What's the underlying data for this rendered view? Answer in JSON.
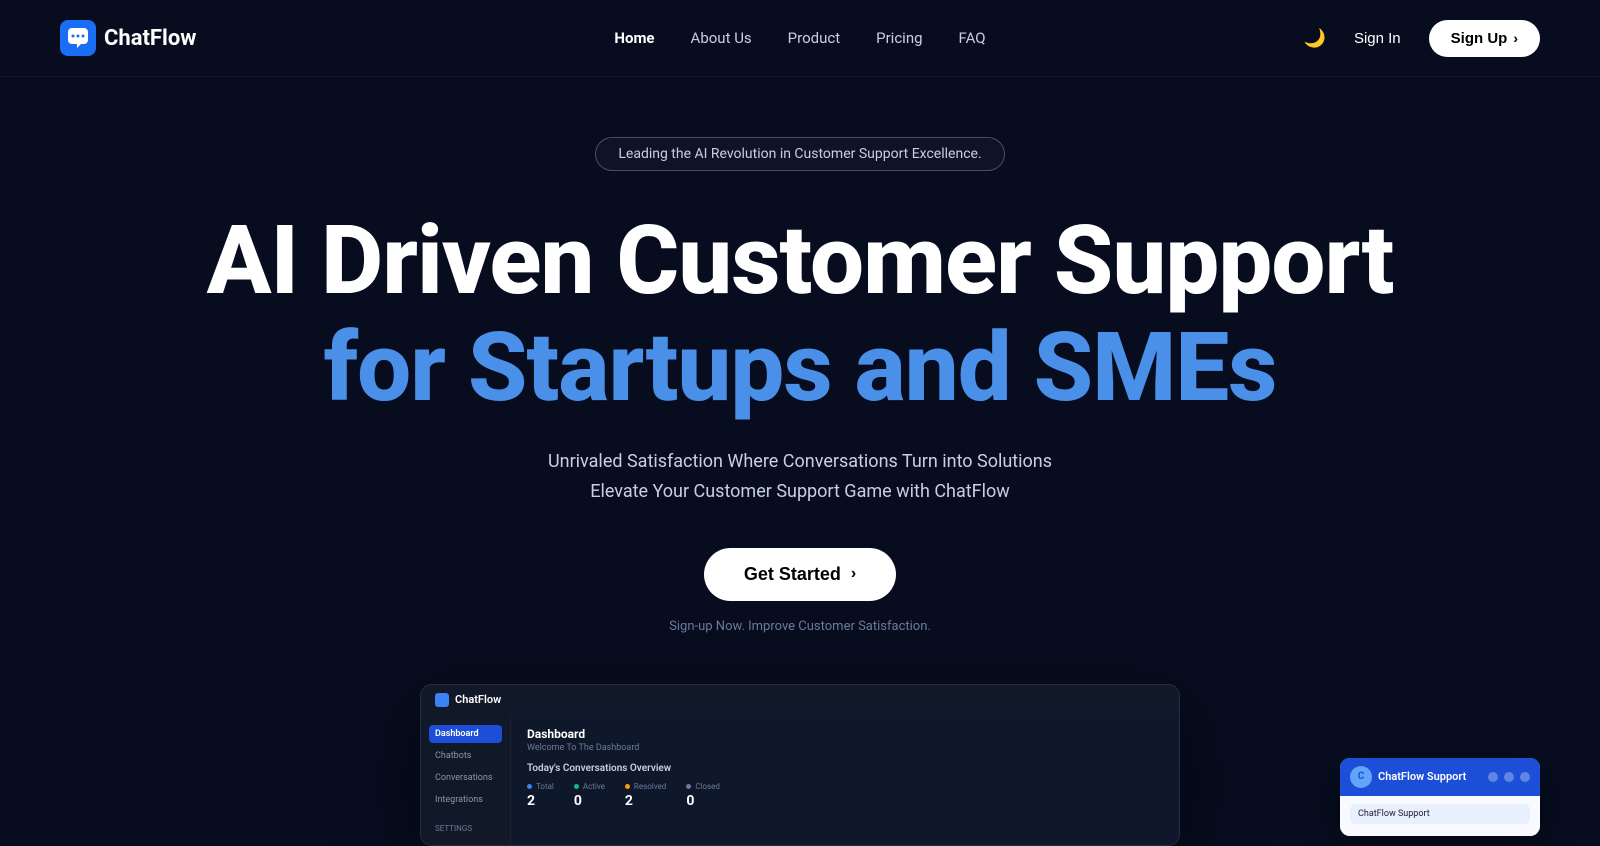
{
  "brand": {
    "name": "ChatFlow",
    "logo_alt": "ChatFlow logo"
  },
  "nav": {
    "links": [
      {
        "label": "Home",
        "active": true
      },
      {
        "label": "About Us",
        "active": false
      },
      {
        "label": "Product",
        "active": false
      },
      {
        "label": "Pricing",
        "active": false
      },
      {
        "label": "FAQ",
        "active": false
      }
    ],
    "sign_in": "Sign In",
    "sign_up": "Sign Up",
    "dark_mode_icon": "🌙"
  },
  "hero": {
    "badge": "Leading the AI Revolution in Customer Support Excellence.",
    "title_line1": "AI Driven Customer Support",
    "title_line2": "for Startups and SMEs",
    "subtitle_line1": "Unrivaled Satisfaction Where Conversations Turn into Solutions",
    "subtitle_line2": "Elevate Your Customer Support Game with ChatFlow",
    "cta_label": "Get Started",
    "footnote": "Sign-up Now. Improve Customer Satisfaction."
  },
  "dashboard": {
    "brand": "ChatFlow",
    "topbar_title": "Dashboard",
    "topbar_subtitle": "Welcome To The Dashboard",
    "sidebar_items": [
      "Dashboard",
      "Chatbots",
      "Conversations",
      "Integrations"
    ],
    "sidebar_settings_label": "SETTINGS",
    "overview_title": "Today's Conversations Overview",
    "stats": [
      {
        "label": "Total",
        "value": "2",
        "dot_color": "blue"
      },
      {
        "label": "Active",
        "value": "0",
        "dot_color": "green"
      },
      {
        "label": "Resolved",
        "value": "2",
        "dot_color": "yellow"
      },
      {
        "label": "Closed",
        "value": "0",
        "dot_color": "gray"
      }
    ]
  },
  "chat_widget": {
    "title": "ChatFlow Support",
    "avatar_initials": "C",
    "message": "ChatFlow Support"
  }
}
